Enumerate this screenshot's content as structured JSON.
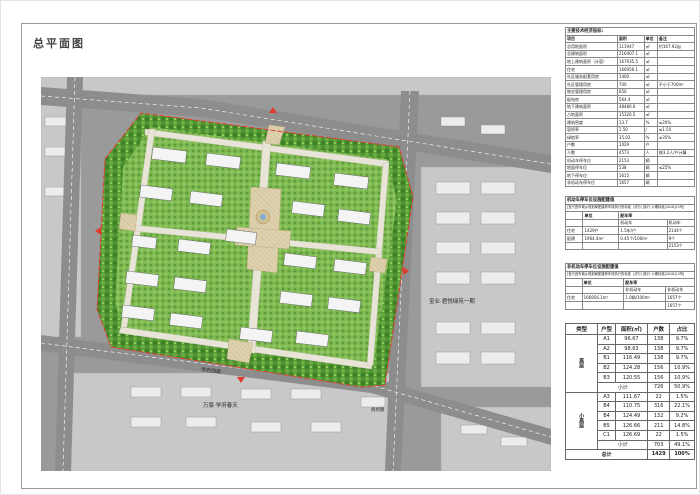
{
  "page": {
    "title": "总平面图"
  },
  "map": {
    "road_labels": [
      "建设路",
      "学府西路",
      "规划路"
    ],
    "neighbor_labels": [
      "宝业·君悦绿苑一期",
      "万豪·学府春天"
    ],
    "colors": {
      "road": "#8d8d8d",
      "green": "#4f9a34",
      "lawn": "#86c25a",
      "plaza": "#d9c9a5",
      "boundary": "#e23b2e",
      "building": "#f4f4f4"
    }
  },
  "tech": {
    "title": "主要技术经济指标:",
    "headers": [
      "项目",
      "面积",
      "单位",
      "备注"
    ],
    "rows": [
      [
        "总用地面积",
        "111947",
        "㎡",
        "约167.92亩"
      ],
      [
        "总建筑面积",
        "216407.1",
        "㎡",
        ""
      ],
      [
        "地上建筑面积（计容）",
        "167935.5",
        "㎡",
        ""
      ],
      [
        "住宅",
        "166956.1",
        "㎡",
        ""
      ],
      [
        "社区服务配套用房",
        "1400",
        "㎡",
        ""
      ],
      [
        "社区管理用房",
        "700",
        "㎡",
        "不小于700m²"
      ],
      [
        "物业管理用房",
        "650",
        "㎡",
        ""
      ],
      [
        "配电房",
        "564.4",
        "㎡",
        ""
      ],
      [
        "地下建筑面积",
        "48486.6",
        "㎡",
        ""
      ],
      [
        "占地面积",
        "15326.5",
        "㎡",
        ""
      ],
      [
        "建筑密度",
        "13.7",
        "%",
        "≤20%"
      ],
      [
        "容积率",
        "1.50",
        "/",
        "≤1.50"
      ],
      [
        "绿地率",
        "35.02",
        "%",
        "≥35%"
      ],
      [
        "户数",
        "1429",
        "户",
        ""
      ],
      [
        "人数",
        "4573",
        "人",
        "按3.2人/户计算"
      ],
      [
        "机动车停车位",
        "2153",
        "辆",
        ""
      ],
      [
        "地面停车位",
        "538",
        "辆",
        "≤25%"
      ],
      [
        "地下停车位",
        "1615",
        "辆",
        ""
      ],
      [
        "非机动车停车位",
        "1657",
        "辆",
        ""
      ]
    ]
  },
  "car": {
    "line1": "机动车停车位设施配建值",
    "line2": "[宜兴宜市城乡规划局配建停车场执行的标准（试行）]执行 六期标准[2018]13号]",
    "head_left": "单位",
    "head_right": "配车率",
    "sub_a": "机动车",
    "sub_b": "机动车",
    "r1": [
      "住宅",
      "1429户",
      "1.5车/户",
      "2144个"
    ],
    "r2": [
      "配建",
      "1964.4m²",
      "0.45个/100m²",
      "9个"
    ],
    "total": "2153个"
  },
  "bike": {
    "line1": "非机动车停车位设施配建值",
    "line2": "[宜兴宜市城乡规划局配建停车场执行的标准（试行）]执行 六期标准[2018]13号]",
    "head_left": "单位",
    "head_right": "配车率",
    "sub_a": "非机动车",
    "sub_b": "非机动车",
    "r1": [
      "住宅",
      "166956.1m²",
      "1.0辆/100m²",
      "1657个"
    ],
    "total": "1657个"
  },
  "units": {
    "headers": [
      "类型",
      "户型",
      "面积(㎡)",
      "户数",
      "占比"
    ],
    "high_label": "高层",
    "small_label": "小高层",
    "high": [
      [
        "A1",
        "96.67",
        "138",
        "9.7%"
      ],
      [
        "A2",
        "98.63",
        "138",
        "9.7%"
      ],
      [
        "B1",
        "116.49",
        "138",
        "9.7%"
      ],
      [
        "B2",
        "124.28",
        "156",
        "10.9%"
      ],
      [
        "B3",
        "120.55",
        "156",
        "10.9%"
      ]
    ],
    "high_sub": [
      "小计",
      "726",
      "50.9%"
    ],
    "small": [
      [
        "A3",
        "111.67",
        "22",
        "1.5%"
      ],
      [
        "B4",
        "110.75",
        "316",
        "22.1%"
      ],
      [
        "B4",
        "124.49",
        "132",
        "9.2%"
      ],
      [
        "B5",
        "126.66",
        "211",
        "14.8%"
      ],
      [
        "C1",
        "126.69",
        "22",
        "1.5%"
      ]
    ],
    "small_sub": [
      "小计",
      "703",
      "49.1%"
    ],
    "total": [
      "总计",
      "1429",
      "100%"
    ]
  }
}
